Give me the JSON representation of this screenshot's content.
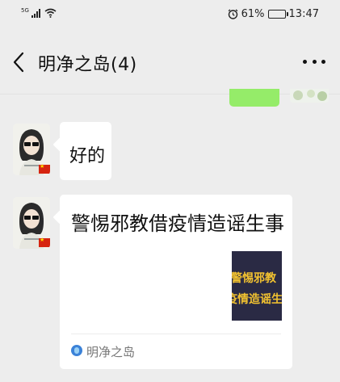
{
  "status_bar": {
    "signal_label": "5G",
    "alarm_icon": "alarm-clock-icon",
    "battery_percent": "61%",
    "battery_level": 0.61,
    "time": "13:47"
  },
  "header": {
    "back_icon": "chevron-left-icon",
    "title": "明净之岛(4)",
    "more_icon": "more-dots-icon"
  },
  "messages": [
    {
      "type": "text",
      "sender_avatar": "avatar-girl-with-flag",
      "text": "好的"
    },
    {
      "type": "link_card",
      "sender_avatar": "avatar-girl-with-flag",
      "title": "警惕邪教借疫情造谣生事",
      "thumbnail_lines": [
        "警惕邪教",
        "疫情造谣生"
      ],
      "source_icon": "official-account-icon",
      "source_name": "明净之岛"
    }
  ],
  "colors": {
    "background": "#ededed",
    "bubble": "#ffffff",
    "self_bubble": "#95ec69",
    "flag_red": "#d62410"
  }
}
